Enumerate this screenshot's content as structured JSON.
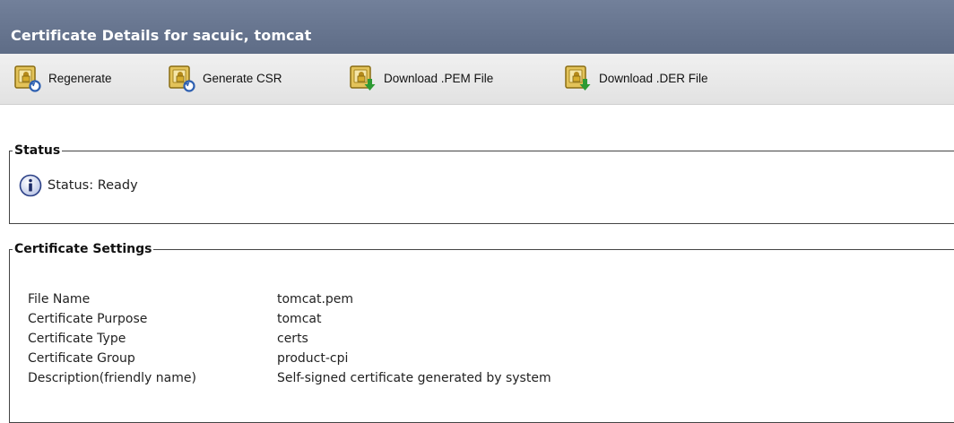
{
  "header": {
    "title": "Certificate Details for sacuic, tomcat"
  },
  "toolbar": {
    "buttons": [
      {
        "label": "Regenerate",
        "icon": "certificate-regenerate-icon"
      },
      {
        "label": "Generate CSR",
        "icon": "certificate-generate-csr-icon"
      },
      {
        "label": "Download .PEM File",
        "icon": "certificate-download-icon"
      },
      {
        "label": "Download .DER File",
        "icon": "certificate-download-icon"
      }
    ]
  },
  "status_section": {
    "legend": "Status",
    "icon": "info-icon",
    "text": "Status: Ready"
  },
  "settings_section": {
    "legend": "Certificate Settings",
    "rows": [
      {
        "key": "File Name",
        "value": "tomcat.pem"
      },
      {
        "key": "Certificate Purpose",
        "value": "tomcat"
      },
      {
        "key": "Certificate Type",
        "value": "certs"
      },
      {
        "key": "Certificate Group",
        "value": "product-cpi"
      },
      {
        "key": "Description(friendly name)",
        "value": "Self-signed certificate generated by system"
      }
    ]
  },
  "colors": {
    "title_bar": "#66748e",
    "toolbar": "#e8e8e8",
    "icon_gold": "#c9a227",
    "icon_blue": "#2d5fb0",
    "icon_green": "#2e9a34"
  }
}
